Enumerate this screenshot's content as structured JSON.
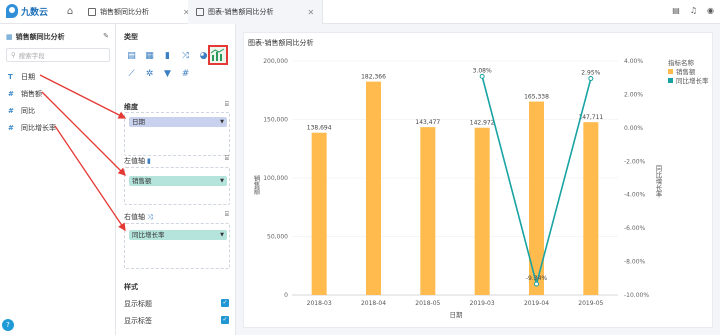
{
  "app": {
    "logo_text": "九数云"
  },
  "tabs": [
    {
      "label": "销售额同比分析"
    },
    {
      "label": "图表-销售额同比分析"
    }
  ],
  "left_panel": {
    "title": "销售额同比分析",
    "search_placeholder": "搜索字段",
    "fields": [
      {
        "type_icon": "T",
        "label": "日期"
      },
      {
        "type_icon": "#",
        "label": "销售额"
      },
      {
        "type_icon": "#",
        "label": "同比"
      },
      {
        "type_icon": "#",
        "label": "同比增长率"
      }
    ]
  },
  "config": {
    "type_title": "类型",
    "dimension_title": "维度",
    "dimension_value": "日期",
    "left_axis_title": "左值轴",
    "left_axis_value": "销售额",
    "right_axis_title": "右值轴",
    "right_axis_value": "同比增长率",
    "style_title": "样式",
    "show_title_label": "显示标题",
    "show_label_label": "显示标签",
    "colors": {
      "dimension_pill": "#c8d2ee",
      "measure_pill": "#b5e4dd",
      "selected_border": "#e53935"
    }
  },
  "chart_data": {
    "type": "bar",
    "title": "图表-销售额同比分析",
    "categories": [
      "2018-03",
      "2018-04",
      "2018-05",
      "2019-03",
      "2019-04",
      "2019-05"
    ],
    "xlabel": "日期",
    "ylabel": "销售额",
    "ylabel_right": "同比增长率",
    "ylim": [
      0,
      200000
    ],
    "y_ticks": [
      "0",
      "50,000",
      "100,000",
      "150,000",
      "200,000"
    ],
    "y2lim": [
      -0.1,
      0.04
    ],
    "y2_ticks": [
      "-10.00%",
      "-8.00%",
      "-6.00%",
      "-4.00%",
      "-2.00%",
      "0.00%",
      "2.00%",
      "4.00%"
    ],
    "series": [
      {
        "name": "销售额",
        "kind": "bar",
        "color": "#ffbb4d",
        "values": [
          138694,
          182366,
          143477,
          142972,
          165338,
          147711
        ],
        "labels": [
          "138,694",
          "182,366",
          "143,477",
          "142,972",
          "165,338",
          "147,711"
        ]
      },
      {
        "name": "同比增长率",
        "kind": "line",
        "color": "#1aa3a3",
        "values": [
          null,
          null,
          null,
          0.0308,
          -0.0934,
          0.0295
        ],
        "labels": [
          "",
          "",
          "",
          "3.08%",
          "-9.34%",
          "2.95%"
        ]
      }
    ],
    "legend_title": "指标名称",
    "legend_position": "right-top"
  }
}
